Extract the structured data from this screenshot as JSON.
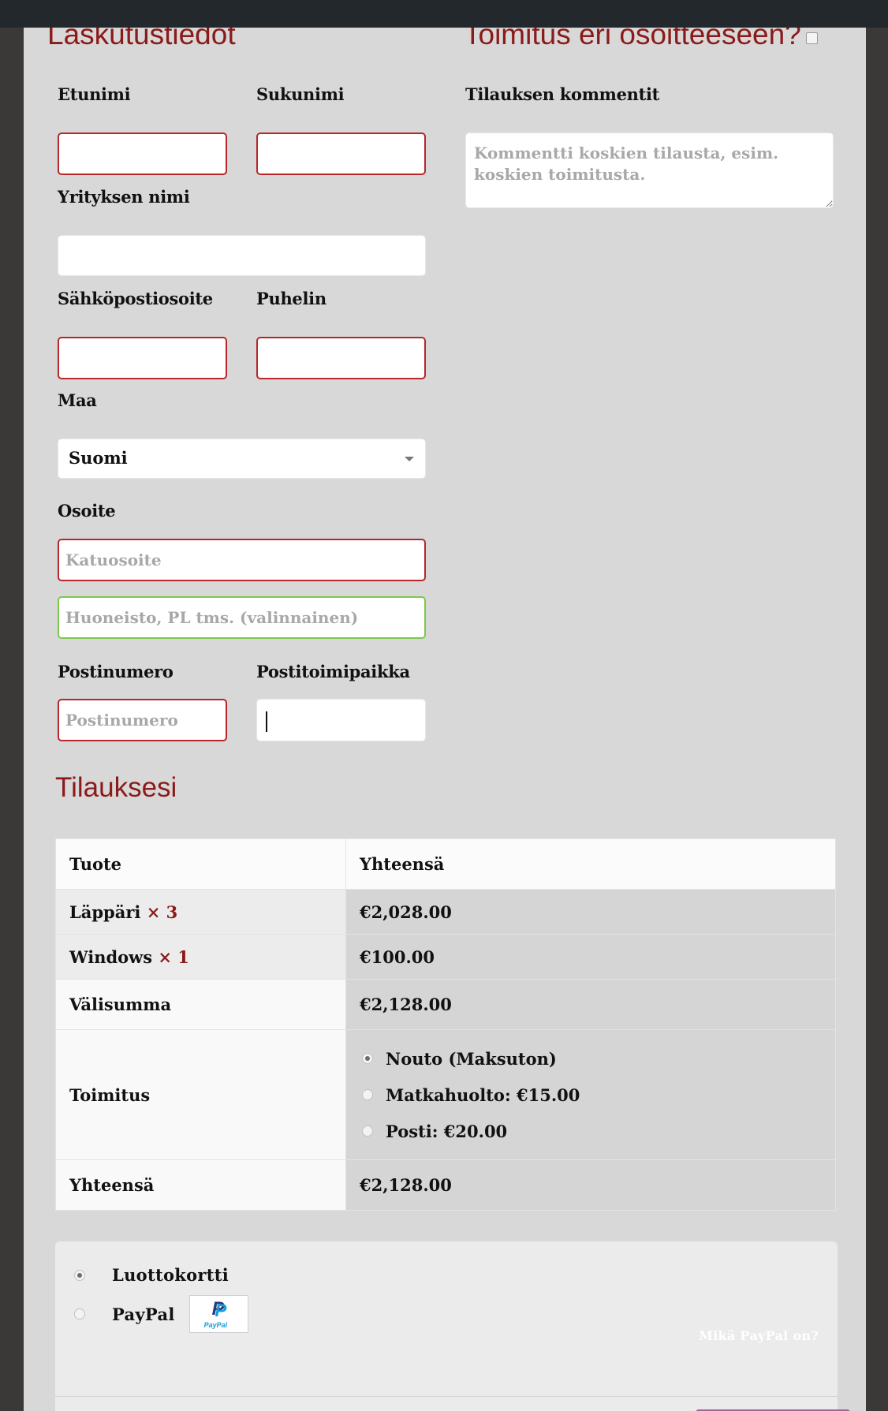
{
  "billing": {
    "heading": "Laskutustiedot",
    "first_name_label": "Etunimi",
    "last_name_label": "Sukunimi",
    "company_label": "Yrityksen nimi",
    "email_label": "Sähköpostiosoite",
    "phone_label": "Puhelin",
    "country_label": "Maa",
    "country_value": "Suomi",
    "address_label": "Osoite",
    "address1_placeholder": "Katuosoite",
    "address2_placeholder": "Huoneisto, PL tms. (valinnainen)",
    "postcode_label": "Postinumero",
    "postcode_placeholder": "Postinumero",
    "city_label": "Postitoimipaikka"
  },
  "shipping": {
    "heading": "Toimitus eri osoitteeseen?",
    "comments_label": "Tilauksen kommentit",
    "comments_placeholder": "Kommentti koskien tilausta, esim. koskien toimitusta."
  },
  "order": {
    "heading": "Tilauksesi",
    "col_product": "Tuote",
    "col_total": "Yhteensä",
    "items": [
      {
        "name": "Läppäri",
        "qty": "× 3",
        "total": "€2,028.00"
      },
      {
        "name": "Windows",
        "qty": "× 1",
        "total": "€100.00"
      }
    ],
    "subtotal_label": "Välisumma",
    "subtotal_value": "€2,128.00",
    "shipping_label": "Toimitus",
    "shipping_options": [
      {
        "label": "Nouto (Maksuton)",
        "selected": true
      },
      {
        "label": "Matkahuolto: €15.00",
        "selected": false
      },
      {
        "label": "Posti: €20.00",
        "selected": false
      }
    ],
    "total_label": "Yhteensä",
    "total_value": "€2,128.00"
  },
  "payment": {
    "methods": [
      {
        "label": "Luottokortti",
        "selected": true
      },
      {
        "label": "PayPal",
        "selected": false
      }
    ],
    "paypal_logo_text": "PayPal",
    "paypal_link": "Mikä PayPal on?"
  },
  "colors": {
    "accent": "#8b1a1a",
    "error_border": "#b8262a",
    "valid_border": "#7cc94a",
    "button": "#a46497"
  }
}
